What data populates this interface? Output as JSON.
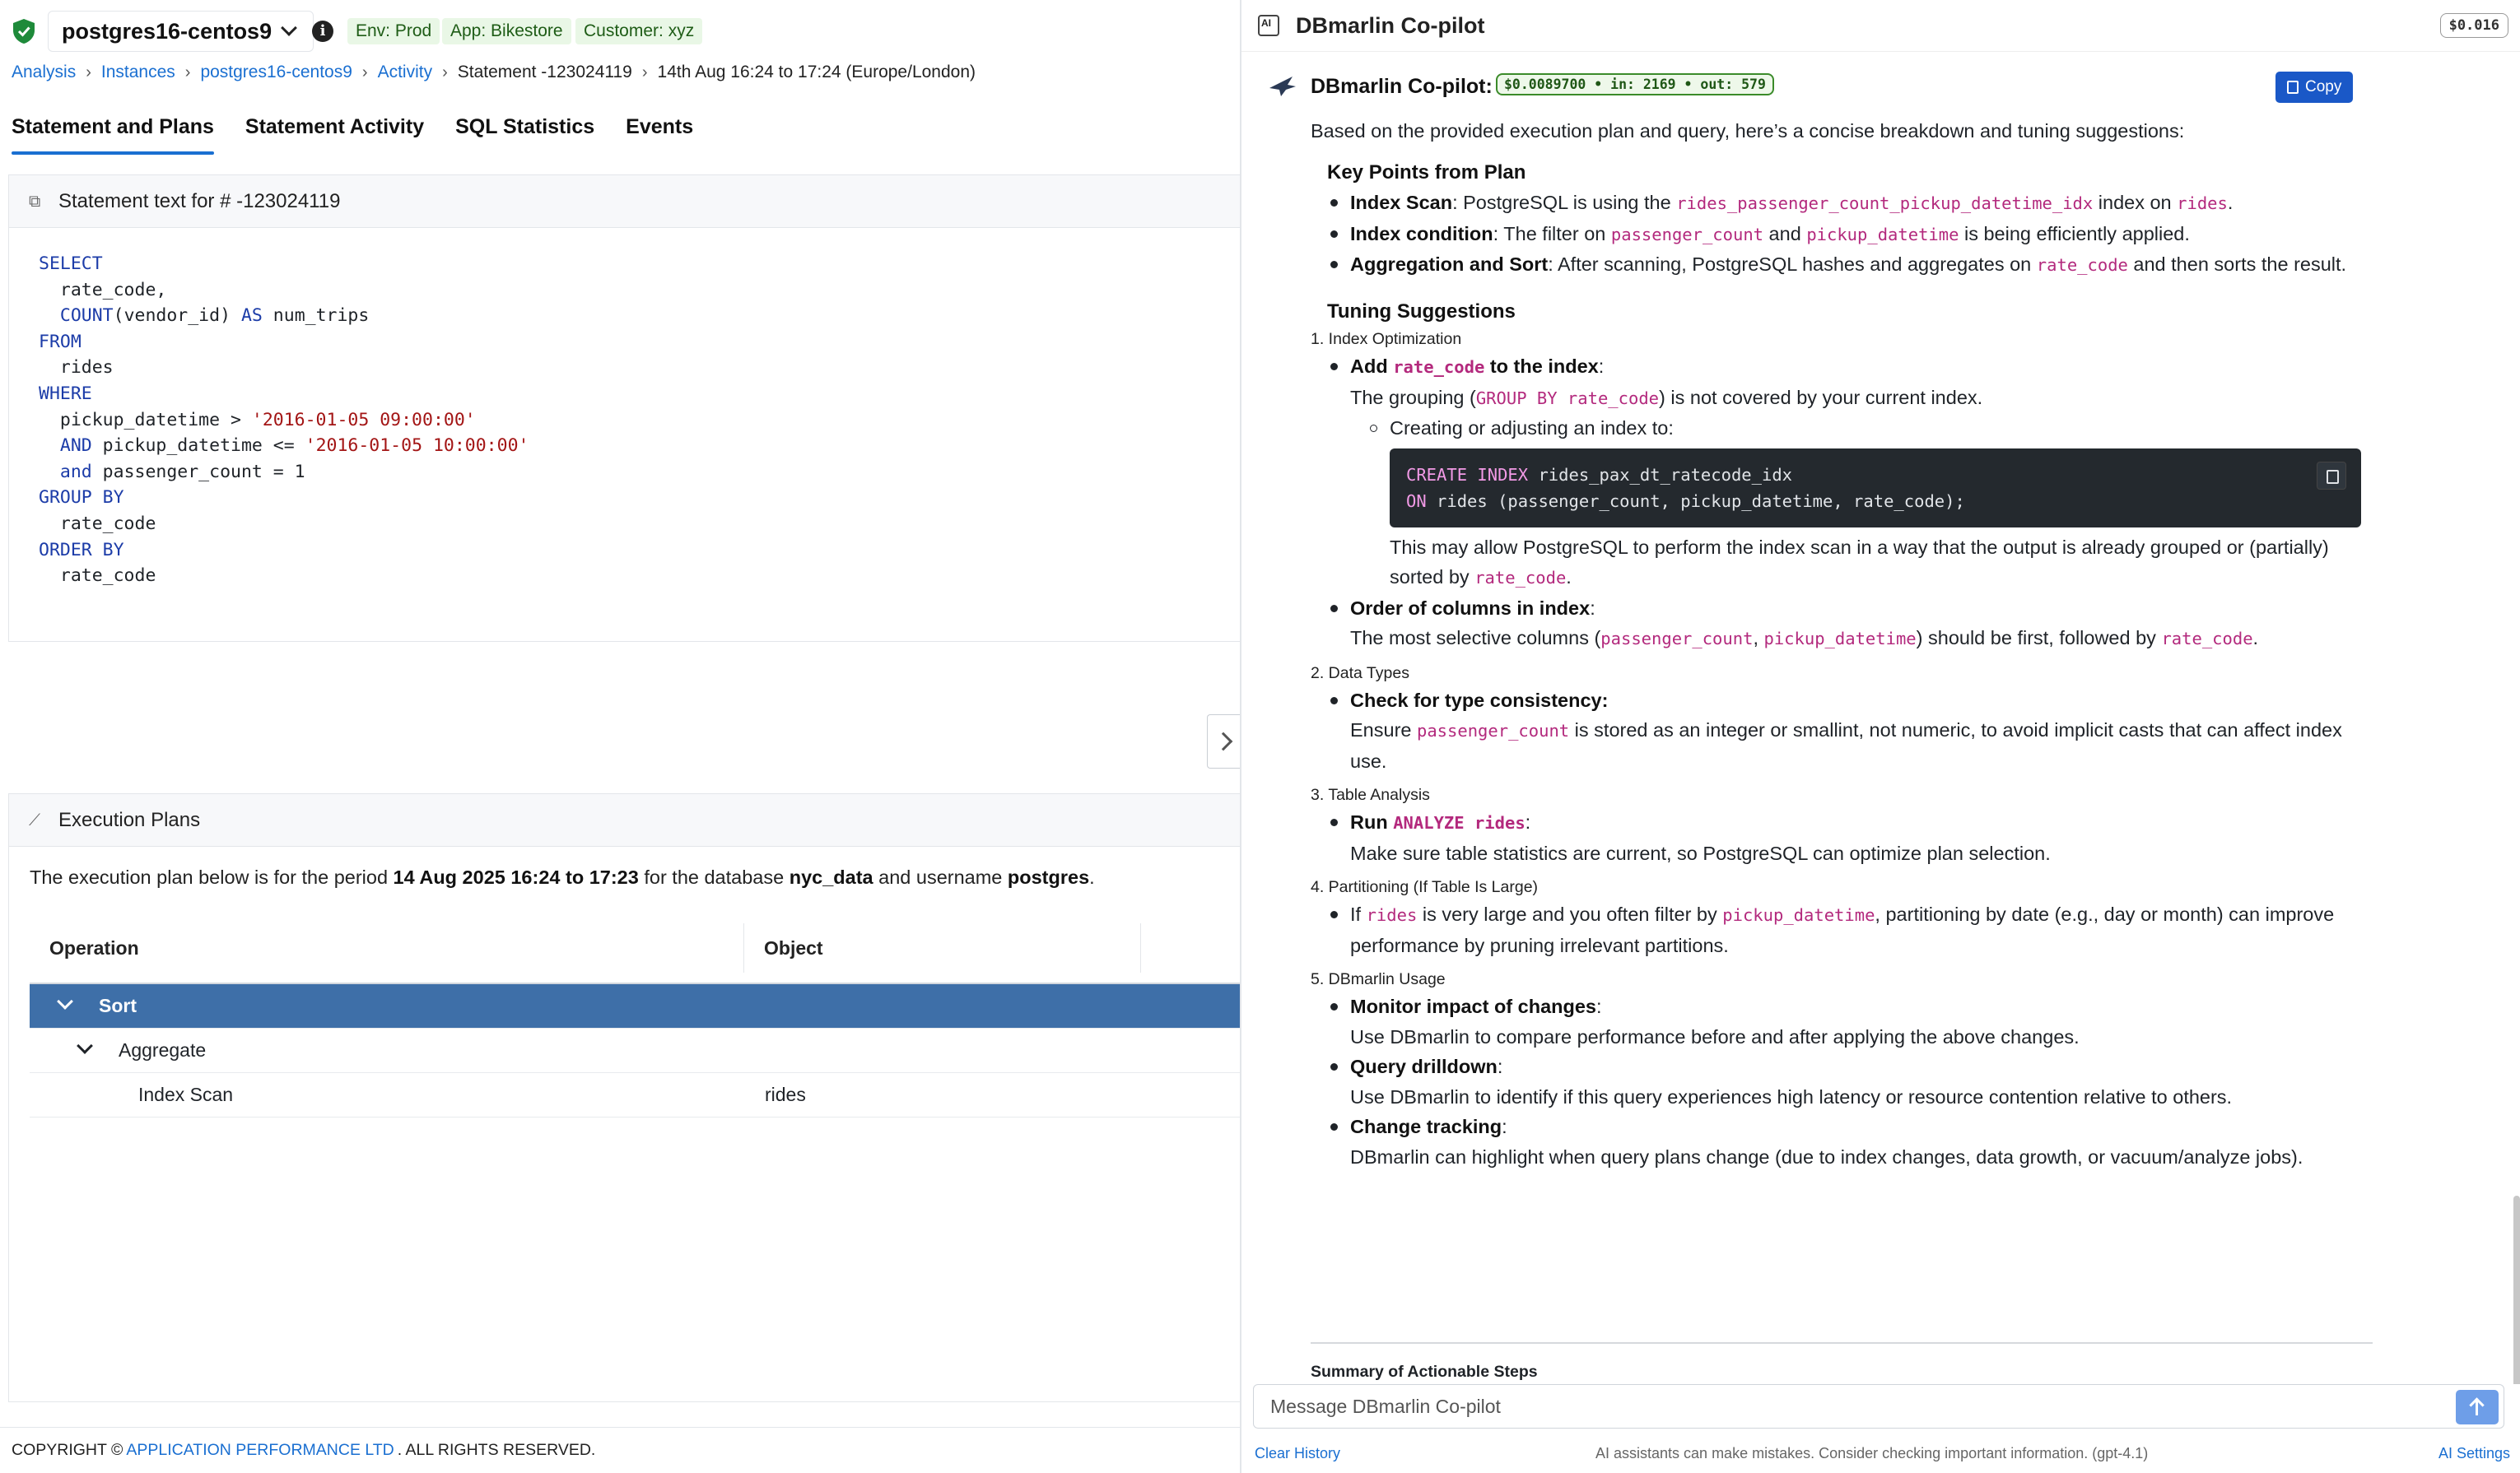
{
  "header": {
    "instance": "postgres16-centos9",
    "tags": [
      "Env: Prod",
      "App: Bikestore",
      "Customer: xyz"
    ]
  },
  "breadcrumb": {
    "items": [
      "Analysis",
      "Instances",
      "postgres16-centos9",
      "Activity"
    ],
    "current": "Statement -123024119",
    "range": "14th Aug 16:24 to 17:24 (Europe/London)"
  },
  "tabs": [
    "Statement and Plans",
    "Statement Activity",
    "SQL Statistics",
    "Events"
  ],
  "statement_panel": {
    "title": "Statement text for # -123024119"
  },
  "sql": {
    "l1": "SELECT",
    "l2": "rate_code,",
    "l3_fn": "COUNT",
    "l3_arg": "(vendor_id) ",
    "l3_kw": "AS",
    "l3_alias": " num_trips",
    "l4": "FROM",
    "l5": "rides",
    "l6": "WHERE",
    "l7_a": "pickup_datetime > ",
    "l7_s": "'2016-01-05 09:00:00'",
    "l8_kw": "AND",
    "l8_a": " pickup_datetime <= ",
    "l8_s": "'2016-01-05 10:00:00'",
    "l9_kw": "and",
    "l9_a": " passenger_count = 1",
    "l10": "GROUP BY",
    "l11": "rate_code",
    "l12": "ORDER BY",
    "l13": "rate_code"
  },
  "plans_panel": {
    "title": "Execution Plans",
    "desc_pre": "The execution plan below is for the period ",
    "period": "14 Aug 2025 16:24 to 17:23",
    "desc_mid": " for the database ",
    "database": "nyc_data",
    "desc_mid2": " and username ",
    "username": "postgres",
    "desc_end": ".",
    "columns": [
      "Operation",
      "Object"
    ],
    "rows": [
      {
        "op": "Sort",
        "obj": ""
      },
      {
        "op": "Aggregate",
        "obj": ""
      },
      {
        "op": "Index Scan",
        "obj": "rides"
      }
    ]
  },
  "footer": {
    "pre": "COPYRIGHT ©",
    "link": "APPLICATION PERFORMANCE LTD",
    "post": ". ALL RIGHTS RESERVED."
  },
  "copilot": {
    "title": "DBmarlin Co-pilot",
    "total_cost": "$0.016",
    "bot_name": "DBmarlin Co-pilot:",
    "usage": "$0.0089700 • in: 2169 • out: 579",
    "copy_label": "Copy",
    "intro": "Based on the provided execution plan and query, here’s a concise breakdown and tuning suggestions:",
    "key_points_title": "Key Points from Plan",
    "kp1_b": "Index Scan",
    "kp1_a": ": PostgreSQL is using the ",
    "kp1_c1": "rides_passenger_count_pickup_datetime_idx",
    "kp1_m": " index on ",
    "kp1_c2": "rides",
    "kp1_e": ".",
    "kp2_b": "Index condition",
    "kp2_a": ": The filter on ",
    "kp2_c1": "passenger_count",
    "kp2_m": " and ",
    "kp2_c2": "pickup_datetime",
    "kp2_e": " is being efficiently applied.",
    "kp3_b": "Aggregation and Sort",
    "kp3_a": ": After scanning, PostgreSQL hashes and aggregates on ",
    "kp3_c1": "rate_code",
    "kp3_e": " and then sorts the result.",
    "tuning_title": "Tuning Suggestions",
    "s1": "1. Index Optimization",
    "s1_b1_pre": "Add ",
    "s1_b1_code": "rate_code",
    "s1_b1_post": " to the index",
    "s1_b1_colon": ":",
    "s1_b1_t1": "The grouping (",
    "s1_b1_c": "GROUP BY rate_code",
    "s1_b1_t2": ") is not covered by your current index.",
    "s1_sub": "Creating or adjusting an index to:",
    "code_l1_kw": "CREATE INDEX",
    "code_l1": " rides_pax_dt_ratecode_idx",
    "code_l2_kw": "ON",
    "code_l2": " rides (passenger_count, pickup_datetime, rate_code);",
    "s1_after": "This may allow PostgreSQL to perform the index scan in a way that the output is already grouped or (partially) sorted by ",
    "s1_after_c": "rate_code",
    "s1_after_e": ".",
    "s1_b2": "Order of columns in index",
    "s1_b2_colon": ":",
    "s1_b2_t1": "The most selective columns (",
    "s1_b2_c1": "passenger_count",
    "s1_b2_comma": ", ",
    "s1_b2_c2": "pickup_datetime",
    "s1_b2_t2": ") should be first, followed by ",
    "s1_b2_c3": "rate_code",
    "s1_b2_e": ".",
    "s2": "2. Data Types",
    "s2_b": "Check for type consistency:",
    "s2_t1": "Ensure ",
    "s2_c": "passenger_count",
    "s2_t2": " is stored as an integer or smallint, not numeric, to avoid implicit casts that can affect index use.",
    "s3": "3. Table Analysis",
    "s3_b": "Run ",
    "s3_c": "ANALYZE rides",
    "s3_colon": ":",
    "s3_t": "Make sure table statistics are current, so PostgreSQL can optimize plan selection.",
    "s4": "4. Partitioning (If Table Is Large)",
    "s4_t1": "If ",
    "s4_c1": "rides",
    "s4_t2": " is very large and you often filter by ",
    "s4_c2": "pickup_datetime",
    "s4_t3": ", partitioning by date (e.g., day or month) can improve performance by pruning irrelevant partitions.",
    "s5": "5. DBmarlin Usage",
    "s5_b1": "Monitor impact of changes",
    "s5_t1": "Use DBmarlin to compare performance before and after applying the above changes.",
    "s5_b2": "Query drilldown",
    "s5_t2": "Use DBmarlin to identify if this query experiences high latency or resource contention relative to others.",
    "s5_b3": "Change tracking",
    "s5_t3": "DBmarlin can highlight when query plans change (due to index changes, data growth, or vacuum/analyze jobs).",
    "colon": ":",
    "summary_title": "Summary of Actionable Steps",
    "input_placeholder": "Message DBmarlin Co-pilot",
    "clear_history": "Clear History",
    "disclaimer": "AI assistants can make mistakes. Consider checking important information. (gpt-4.1)",
    "ai_settings": "AI Settings"
  }
}
